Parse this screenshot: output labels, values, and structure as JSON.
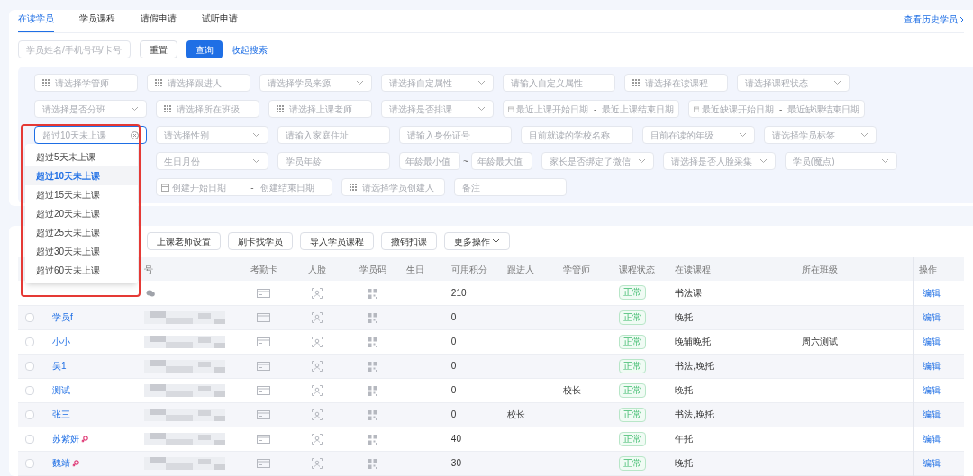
{
  "tabs": [
    {
      "label": "在读学员",
      "selected": true
    },
    {
      "label": "学员课程",
      "selected": false
    },
    {
      "label": "请假申请",
      "selected": false
    },
    {
      "label": "试听申请",
      "selected": false
    }
  ],
  "history_link": "查看历史学员",
  "search": {
    "placeholder": "学员姓名/手机号码/卡号",
    "reset": "重置",
    "query": "查询",
    "collapse": "收起搜索"
  },
  "filter_rows": [
    {
      "indented": false,
      "fields": [
        {
          "kind": "picker",
          "placeholder": "请选择学管师"
        },
        {
          "kind": "picker",
          "placeholder": "请选择跟进人"
        },
        {
          "kind": "select",
          "placeholder": "请选择学员来源"
        },
        {
          "kind": "select",
          "placeholder": "请选择自定属性"
        },
        {
          "kind": "text",
          "placeholder": "请输入自定义属性"
        },
        {
          "kind": "picker",
          "placeholder": "请选择在读课程"
        },
        {
          "kind": "select",
          "placeholder": "请选择课程状态"
        }
      ]
    },
    {
      "indented": false,
      "fields": [
        {
          "kind": "select",
          "placeholder": "请选择是否分班"
        },
        {
          "kind": "picker",
          "placeholder": "请选择所在班级"
        },
        {
          "kind": "picker",
          "placeholder": "请选择上课老师"
        },
        {
          "kind": "select",
          "placeholder": "请选择是否排课"
        },
        {
          "kind": "date-range",
          "start": "最近上课开始日期",
          "sep": "-",
          "end": "最近上课结束日期"
        },
        {
          "kind": "date-range",
          "start": "最近缺课开始日期",
          "sep": "-",
          "end": "最近缺课结束日期"
        }
      ]
    },
    {
      "indented": false,
      "fields": [
        {
          "kind": "open-select",
          "value": "超过10天未上课"
        },
        {
          "kind": "select",
          "placeholder": "请选择性别"
        },
        {
          "kind": "text",
          "placeholder": "请输入家庭住址"
        },
        {
          "kind": "text",
          "placeholder": "请输入身份证号"
        },
        {
          "kind": "text",
          "placeholder": "目前就读的学校名称"
        },
        {
          "kind": "select",
          "placeholder": "目前在读的年级"
        },
        {
          "kind": "select",
          "placeholder": "请选择学员标签"
        }
      ]
    },
    {
      "indented": true,
      "fields": [
        {
          "kind": "select",
          "placeholder": "生日月份"
        },
        {
          "kind": "text",
          "placeholder": "学员年龄"
        },
        {
          "kind": "range",
          "min": "年龄最小值",
          "sep": "~",
          "max": "年龄最大值"
        },
        {
          "kind": "select",
          "placeholder": "家长是否绑定了微信"
        },
        {
          "kind": "select",
          "placeholder": "请选择是否人脸采集"
        },
        {
          "kind": "select",
          "placeholder": "学员(魔点)"
        }
      ]
    },
    {
      "indented": true,
      "fields": [
        {
          "kind": "date-range",
          "start": "创建开始日期",
          "sep": "-",
          "end": "创建结束日期"
        },
        {
          "kind": "picker",
          "placeholder": "请选择学员创建人"
        },
        {
          "kind": "text",
          "placeholder": "备注"
        }
      ]
    }
  ],
  "dropdown_options": [
    {
      "label": "超过5天未上课",
      "selected": false
    },
    {
      "label": "超过10天未上课",
      "selected": true
    },
    {
      "label": "超过15天未上课",
      "selected": false
    },
    {
      "label": "超过20天未上课",
      "selected": false
    },
    {
      "label": "超过25天未上课",
      "selected": false
    },
    {
      "label": "超过30天未上课",
      "selected": false
    },
    {
      "label": "超过60天未上课",
      "selected": false
    }
  ],
  "toolbar": [
    "上课老师设置",
    "刷卡找学员",
    "导入学员课程",
    "撤销扣课",
    "更多操作"
  ],
  "table": {
    "columns": [
      "",
      "",
      "号",
      "考勤卡",
      "人脸",
      "学员码",
      "生日",
      "可用积分",
      "跟进人",
      "学管师",
      "课程状态",
      "在读课程",
      "所在班级",
      "操作"
    ],
    "rows": [
      {
        "wechat_bound": true,
        "points": "210",
        "status": "正常",
        "course": "书法课",
        "action": "编辑"
      },
      {
        "checked": false,
        "name": "学员f",
        "female": false,
        "wechat_bound": false,
        "points": "0",
        "status": "正常",
        "course": "晚托",
        "action": "编辑"
      },
      {
        "checked": false,
        "name": "小小",
        "female": false,
        "wechat_bound": false,
        "points": "0",
        "status": "正常",
        "course": "晚辅晚托",
        "class": "周六测试",
        "action": "编辑"
      },
      {
        "checked": false,
        "name": "吴1",
        "female": false,
        "wechat_bound": false,
        "points": "0",
        "status": "正常",
        "course": "书法,晚托",
        "action": "编辑"
      },
      {
        "checked": false,
        "name": "测试",
        "female": false,
        "wechat_bound": false,
        "points": "0",
        "manager": "校长",
        "status": "正常",
        "course": "晚托",
        "action": "编辑"
      },
      {
        "checked": false,
        "name": "张三",
        "female": false,
        "wechat_bound": false,
        "points": "0",
        "follower": "校长",
        "status": "正常",
        "course": "书法,晚托",
        "action": "编辑"
      },
      {
        "checked": false,
        "name": "苏紫妍",
        "female": true,
        "wechat_bound": false,
        "points": "40",
        "status": "正常",
        "course": "午托",
        "action": "编辑"
      },
      {
        "checked": false,
        "name": "魏靖",
        "female": true,
        "wechat_bound": false,
        "points": "30",
        "status": "正常",
        "course": "晚托",
        "action": "编辑"
      }
    ]
  }
}
